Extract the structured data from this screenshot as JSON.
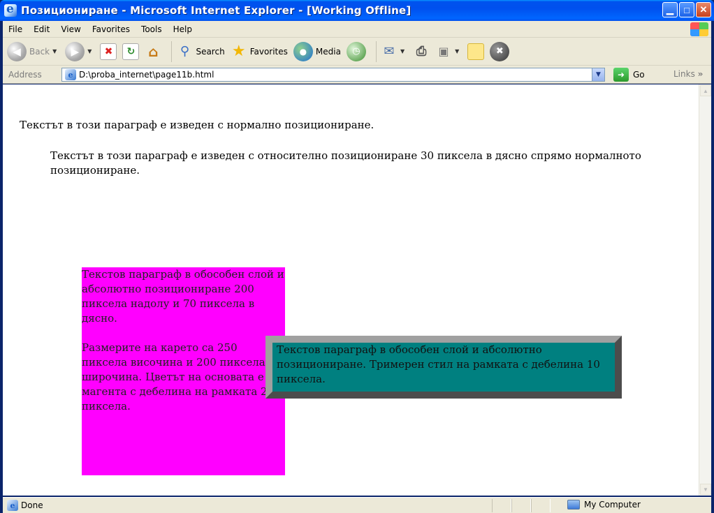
{
  "window": {
    "title": "Позициониране - Microsoft Internet Explorer - [Working Offline]",
    "buttons": {
      "minimize": "▁",
      "maximize": "□",
      "close": "✕"
    }
  },
  "menu": {
    "items": [
      "File",
      "Edit",
      "View",
      "Favorites",
      "Tools",
      "Help"
    ]
  },
  "toolbar": {
    "back_label": "Back",
    "search_label": "Search",
    "favorites_label": "Favorites",
    "media_label": "Media"
  },
  "address": {
    "label": "Address",
    "url": "D:\\proba_internet\\page11b.html",
    "go_label": "Go",
    "links_label": "Links"
  },
  "content": {
    "paragraph_normal": "Текстът в този параграф е изведен с нормално позициониране.",
    "paragraph_relative": "Текстът в този параграф е изведен с относително позициониране 30 пиксела в дясно спрямо нормалното позициониране.",
    "magenta_box": {
      "para1": "Текстов параграф в обособен слой и абсолютно позициониране 200 пиксела надолу и 70 пиксела в дясно.",
      "para2": "Размерите на карето са 250 пиксела височина и 200 пиксела широчина. Цветът на основата е магента с дебелина на рамката 2 пиксела."
    },
    "teal_box": "Текстов параграф в обособен слой и абсолютно позициониране. Тримерен стил на рамката с дебелина 10 пиксела."
  },
  "status": {
    "text": "Done",
    "zone": "My Computer"
  },
  "colors": {
    "magenta_box": "#ff00ff",
    "teal_box": "#008080",
    "title_bar": "#0053ee"
  }
}
